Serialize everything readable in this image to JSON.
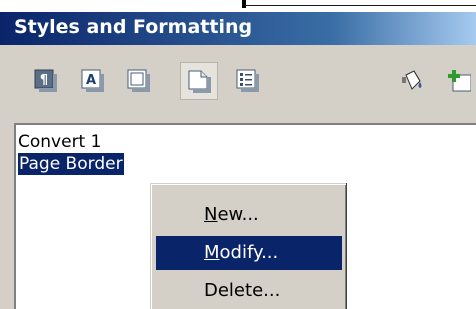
{
  "panel": {
    "title": "Styles and Formatting"
  },
  "toolbar": {
    "buttons": [
      {
        "icon": "paragraph-styles-icon"
      },
      {
        "icon": "character-styles-icon"
      },
      {
        "icon": "frame-styles-icon"
      },
      {
        "icon": "page-styles-icon",
        "active": true
      },
      {
        "icon": "list-styles-icon"
      },
      {
        "icon": "fill-format-mode-icon"
      },
      {
        "icon": "new-style-from-selection-icon"
      }
    ]
  },
  "styles_list": {
    "items": [
      {
        "label": "Convert 1"
      },
      {
        "label": "Page Border",
        "selected": true
      }
    ]
  },
  "context_menu": {
    "items": [
      {
        "label": "New...",
        "accel": "N",
        "rest": "ew..."
      },
      {
        "label": "Modify...",
        "accel": "M",
        "rest": "odify...",
        "highlighted": true
      },
      {
        "label": "Delete...",
        "accel": "",
        "rest": "Delete..."
      }
    ]
  },
  "colors": {
    "title_bar": "#0a246a",
    "selection": "#0a246a",
    "panel_bg": "#d4d0c8"
  }
}
